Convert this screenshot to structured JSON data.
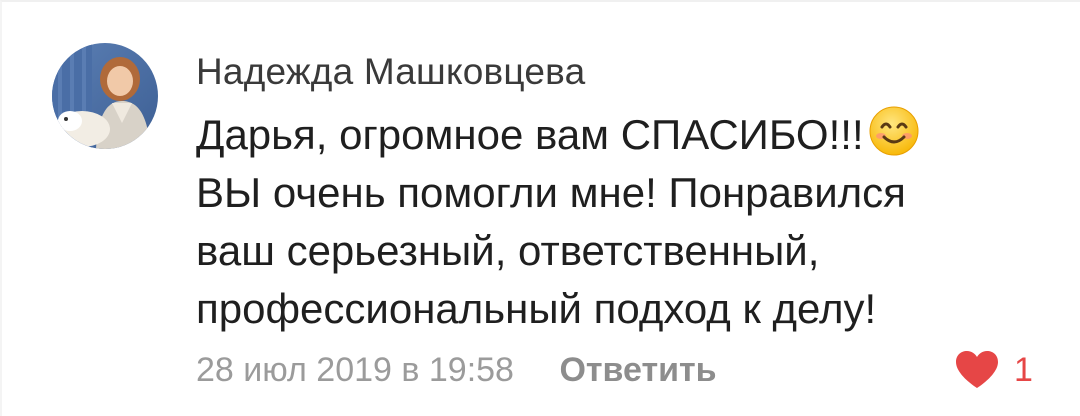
{
  "comment": {
    "author": "Надежда Машковцева",
    "lines": [
      "Дарья, огромное вам СПАСИБО!!!",
      "ВЫ очень помогли мне! Понравился",
      "ваш серьезный, ответственный,",
      "профессиональный подход к делу!"
    ],
    "emoji_icon": "smiling-face-icon",
    "date": "28 июл 2019 в 19:58",
    "reply_label": "Ответить",
    "like_icon": "heart-icon",
    "like_count": "1"
  },
  "colors": {
    "author": "#3a3a3a",
    "text": "#1f1f1f",
    "meta": "#9b9b9b",
    "like": "#e64646"
  }
}
